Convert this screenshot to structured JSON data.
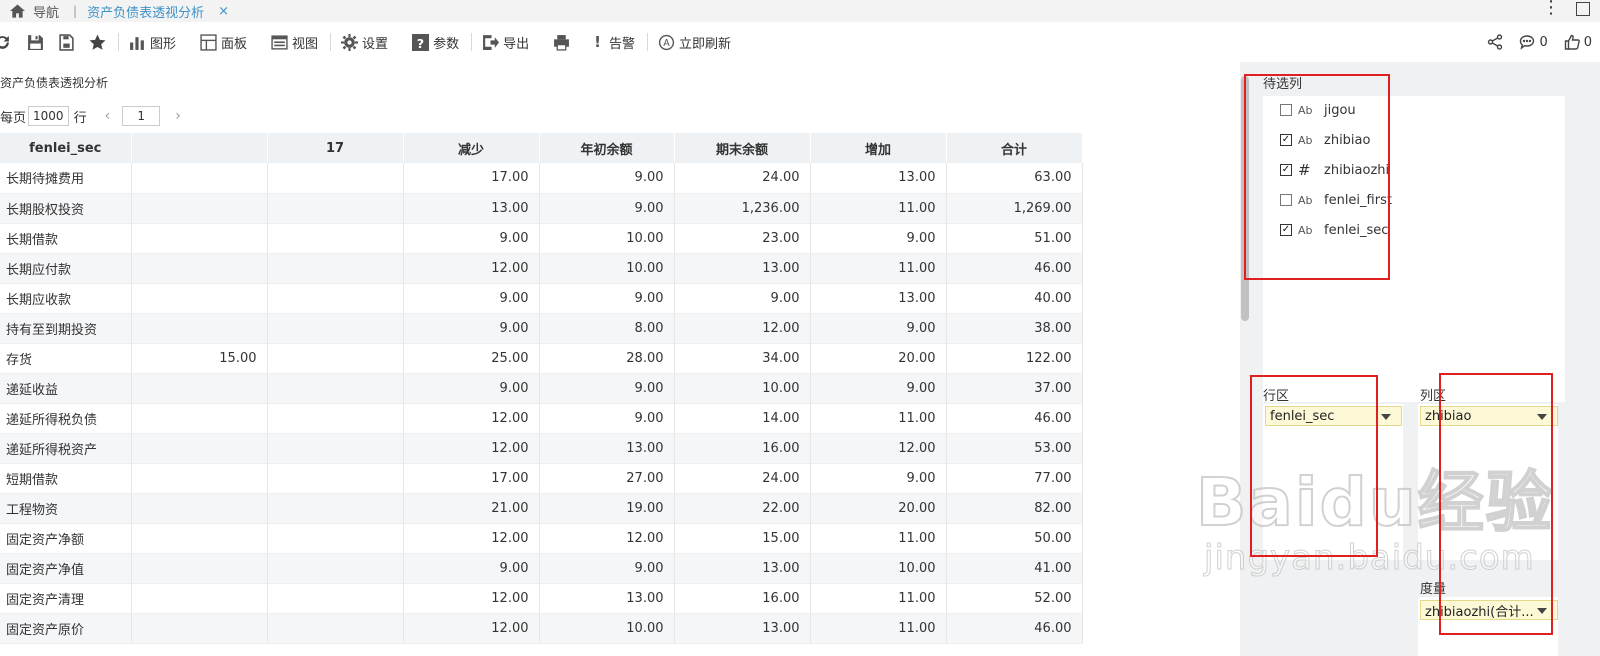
{
  "tabs": {
    "home_label": "导航",
    "separator": "|",
    "active_label": "资产负债表透视分析",
    "close_glyph": "×"
  },
  "toolbar": {
    "buttons": [
      {
        "icon": "refresh-icon",
        "label": ""
      },
      {
        "icon": "save-icon",
        "label": ""
      },
      {
        "icon": "save-as-icon",
        "label": ""
      },
      {
        "icon": "star-icon",
        "label": ""
      },
      {
        "icon": "chart-icon",
        "label": "图形"
      },
      {
        "icon": "panel-icon",
        "label": "面板"
      },
      {
        "icon": "view-icon",
        "label": "视图"
      },
      {
        "icon": "gear-icon",
        "label": "设置"
      },
      {
        "icon": "help-icon",
        "label": "参数"
      },
      {
        "icon": "export-icon",
        "label": "导出"
      },
      {
        "icon": "print-icon",
        "label": ""
      },
      {
        "icon": "alert-icon",
        "label": "告警"
      },
      {
        "icon": "refresh-now-icon",
        "label": "立即刷新"
      }
    ],
    "comment_count": "0",
    "like_count": "0"
  },
  "report": {
    "title": "资产负债表透视分析",
    "pager": {
      "per_page_label": "每页",
      "per_page_value": "1000",
      "row_unit": "行",
      "prev": "‹",
      "page": "1",
      "next": "›"
    },
    "columns": [
      "fenlei_sec",
      "",
      "17",
      "减少",
      "年初余额",
      "期末余额",
      "增加",
      "合计"
    ],
    "rows": [
      [
        "长期待摊费用",
        "",
        "",
        "17.00",
        "9.00",
        "24.00",
        "13.00",
        "63.00"
      ],
      [
        "长期股权投资",
        "",
        "",
        "13.00",
        "9.00",
        "1,236.00",
        "11.00",
        "1,269.00"
      ],
      [
        "长期借款",
        "",
        "",
        "9.00",
        "10.00",
        "23.00",
        "9.00",
        "51.00"
      ],
      [
        "长期应付款",
        "",
        "",
        "12.00",
        "10.00",
        "13.00",
        "11.00",
        "46.00"
      ],
      [
        "长期应收款",
        "",
        "",
        "9.00",
        "9.00",
        "9.00",
        "13.00",
        "40.00"
      ],
      [
        "持有至到期投资",
        "",
        "",
        "9.00",
        "8.00",
        "12.00",
        "9.00",
        "38.00"
      ],
      [
        "存货",
        "15.00",
        "",
        "25.00",
        "28.00",
        "34.00",
        "20.00",
        "122.00"
      ],
      [
        "递延收益",
        "",
        "",
        "9.00",
        "9.00",
        "10.00",
        "9.00",
        "37.00"
      ],
      [
        "递延所得税负债",
        "",
        "",
        "12.00",
        "9.00",
        "14.00",
        "11.00",
        "46.00"
      ],
      [
        "递延所得税资产",
        "",
        "",
        "12.00",
        "13.00",
        "16.00",
        "12.00",
        "53.00"
      ],
      [
        "短期借款",
        "",
        "",
        "17.00",
        "27.00",
        "24.00",
        "9.00",
        "77.00"
      ],
      [
        "工程物资",
        "",
        "",
        "21.00",
        "19.00",
        "22.00",
        "20.00",
        "82.00"
      ],
      [
        "固定资产净额",
        "",
        "",
        "12.00",
        "12.00",
        "15.00",
        "11.00",
        "50.00"
      ],
      [
        "固定资产净值",
        "",
        "",
        "9.00",
        "9.00",
        "13.00",
        "10.00",
        "41.00"
      ],
      [
        "固定资产清理",
        "",
        "",
        "12.00",
        "13.00",
        "16.00",
        "11.00",
        "52.00"
      ],
      [
        "固定资产原价",
        "",
        "",
        "12.00",
        "10.00",
        "13.00",
        "11.00",
        "46.00"
      ]
    ]
  },
  "panel": {
    "candidates_title": "待选列",
    "fields": [
      {
        "name": "jigou",
        "checked": false,
        "type": "text-icon",
        "type_glyph": "Ab"
      },
      {
        "name": "zhibiao",
        "checked": true,
        "type": "text-icon",
        "type_glyph": "Ab"
      },
      {
        "name": "zhibiaozhi",
        "checked": true,
        "type": "number-icon",
        "type_glyph": "#"
      },
      {
        "name": "fenlei_first",
        "checked": false,
        "type": "text-icon",
        "type_glyph": "Ab"
      },
      {
        "name": "fenlei_sec",
        "checked": true,
        "type": "text-icon",
        "type_glyph": "Ab"
      }
    ],
    "row_zone": {
      "label": "行区",
      "value": "fenlei_sec"
    },
    "col_zone": {
      "label": "列区",
      "value": "zhibiao"
    },
    "measure_zone": {
      "label": "度量",
      "value": "zhibiaozhi(合计..."
    },
    "check_glyph": "✓"
  },
  "watermark": {
    "main": "Baidu经验",
    "sub": "jingyan.baidu.com"
  },
  "colors": {
    "accent": "#3f92c8",
    "header_bg": "#eef2f5",
    "annotation_red": "#e02020",
    "zone_bg": "#fdf9d6"
  }
}
